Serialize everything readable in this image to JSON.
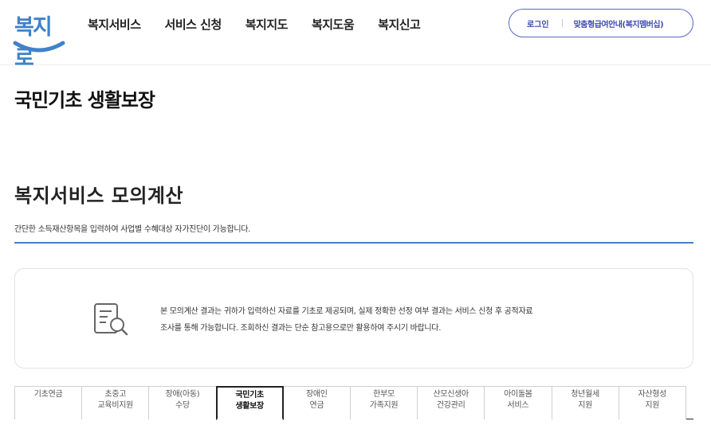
{
  "header": {
    "logo_text": "복지로",
    "nav": [
      "복지서비스",
      "서비스 신청",
      "복지지도",
      "복지도움",
      "복지신고"
    ],
    "login_label": "로그인",
    "info_label": "맞춤형급여안내(복지멤버십)"
  },
  "page_title": "국민기초 생활보장",
  "section": {
    "title": "복지서비스 모의계산",
    "description": "간단한 소득재산항목을 입력하여 사업별 수혜대상 자가진단이 가능합니다."
  },
  "notice": {
    "icon": "document-search-icon",
    "line1": "본 모의계산 결과는 귀하가 입력하신 자료를 기초로 제공되며, 실제 정확한 선정 여부 결과는 서비스 신청 후 공적자료",
    "line2": "조사를 통해 가능합니다. 조회하신 결과는 단순 참고용으로만 활용하여 주시기 바랍니다."
  },
  "tabs": [
    {
      "line1": "기초연금",
      "line2": ""
    },
    {
      "line1": "초중고",
      "line2": "교육비지원"
    },
    {
      "line1": "장애(아동)",
      "line2": "수당"
    },
    {
      "line1": "국민기초",
      "line2": "생활보장"
    },
    {
      "line1": "장애인",
      "line2": "연금"
    },
    {
      "line1": "한부모",
      "line2": "가족지원"
    },
    {
      "line1": "산모신생아",
      "line2": "건강관리"
    },
    {
      "line1": "아이돌봄",
      "line2": "서비스"
    },
    {
      "line1": "청년월세",
      "line2": "지원"
    },
    {
      "line1": "자산형성",
      "line2": "지원"
    }
  ],
  "active_tab_index": 3,
  "colors": {
    "brand_blue": "#3f82c9",
    "util_border": "#5a67c6",
    "util_text": "#3e4bb0"
  }
}
